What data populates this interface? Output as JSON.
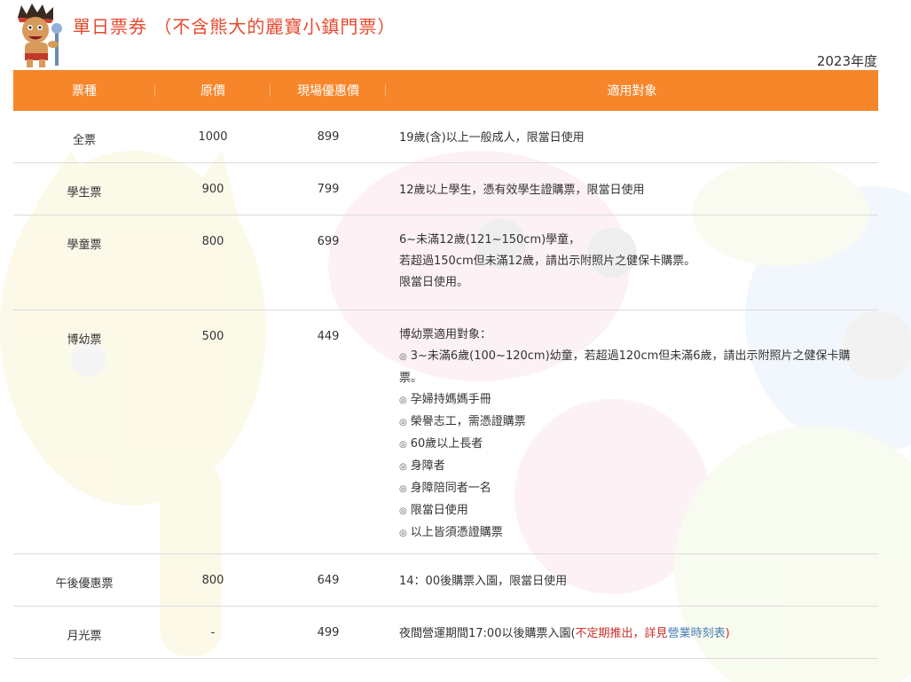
{
  "header": {
    "title": "單日票券",
    "subtitle": "（不含熊大的麗寶小鎮門票）",
    "year": "2023年度"
  },
  "table": {
    "columns": [
      "票種",
      "原價",
      "現場優惠價",
      "適用對象"
    ],
    "rows": [
      {
        "type": "全票",
        "original": "1000",
        "onsite": "899",
        "desc": [
          "19歲(含)以上一般成人，限當日使用"
        ]
      },
      {
        "type": "學生票",
        "original": "900",
        "onsite": "799",
        "desc": [
          "12歲以上學生，憑有效學生證購票，限當日使用"
        ]
      },
      {
        "type": "學童票",
        "original": "800",
        "onsite": "699",
        "desc": [
          "6~未滿12歲(121~150cm)學童，",
          "若超過150cm但未滿12歲，請出示附照片之健保卡購票。",
          "限當日使用。"
        ]
      },
      {
        "type": "博幼票",
        "original": "500",
        "onsite": "449",
        "desc_head": "博幼票適用對象：",
        "bullet": "◎",
        "bullets": [
          "3~未滿6歲(100~120cm)幼童，若超過120cm但未滿6歲，請出示附照片之健保卡購票。",
          "孕婦持媽媽手冊",
          "榮譽志工，需憑證購票",
          "60歲以上長者",
          "身障者",
          "身障陪同者一名",
          "限當日使用",
          "以上皆須憑證購票"
        ]
      },
      {
        "type": "午後優惠票",
        "original": "800",
        "onsite": "649",
        "desc": [
          "14：00後購票入園，限當日使用"
        ]
      },
      {
        "type": "月光票",
        "original": "-",
        "onsite": "499",
        "desc_pre": "夜間營運期間17:00以後購票入園(",
        "desc_note": "不定期推出，詳見",
        "desc_link": "營業時刻表",
        "desc_post": ")"
      }
    ]
  },
  "colors": {
    "header_bg": "#f7862a",
    "title": "#e64a2e",
    "note": "#c8302a"
  }
}
